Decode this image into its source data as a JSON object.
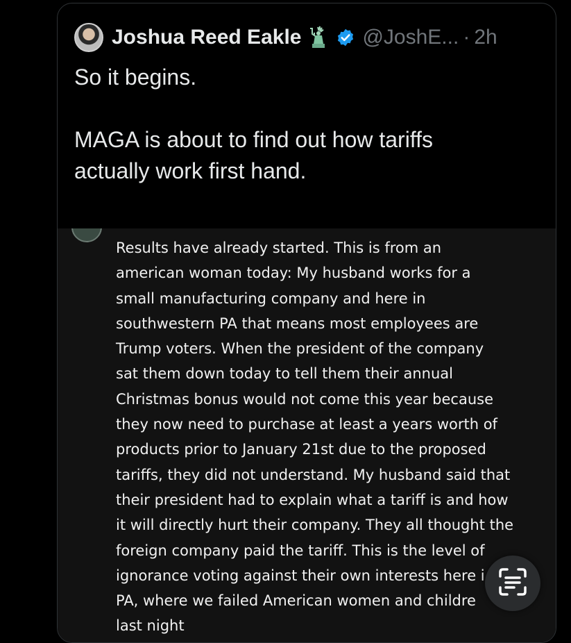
{
  "tweet": {
    "author_name": "Joshua Reed Eakle",
    "handle": "@JoshE...",
    "separator": "·",
    "time": "2h",
    "lines": [
      "So it begins.",
      "",
      "MAGA is about to find out how tariffs",
      "actually work first hand."
    ],
    "badges": [
      "statue-of-liberty-icon",
      "verified-badge-icon"
    ]
  },
  "embedded_image": {
    "lines": [
      "Results have already started.  This is from an",
      "american woman today: My husband works for a",
      "small manufacturing company and here in",
      "southwestern PA that means most employees are",
      "Trump voters. When the president of the company",
      "sat them down today to tell them their annual",
      "Christmas bonus would not come this year because",
      "they now need to purchase at least a years worth of",
      "products prior to January 21st due to the proposed",
      "tariffs, they did not understand. My husband said that",
      "their president had to explain what a tariff is and how",
      "it will directly hurt their company. They all thought the",
      "foreign company paid the tariff. This is the level of",
      "ignorance voting against their own interests here i",
      "PA, where we failed American women and childre",
      "last night"
    ]
  },
  "overlay": {
    "icon": "text-scan-icon",
    "colors": {
      "button_bg": "#2a2c2e",
      "icon": "#ffffff"
    }
  },
  "colors": {
    "background": "#000000",
    "text": "#e7e9ea",
    "muted": "#71767b",
    "verified": "#1d9bf0",
    "media_bg": "#121212"
  }
}
